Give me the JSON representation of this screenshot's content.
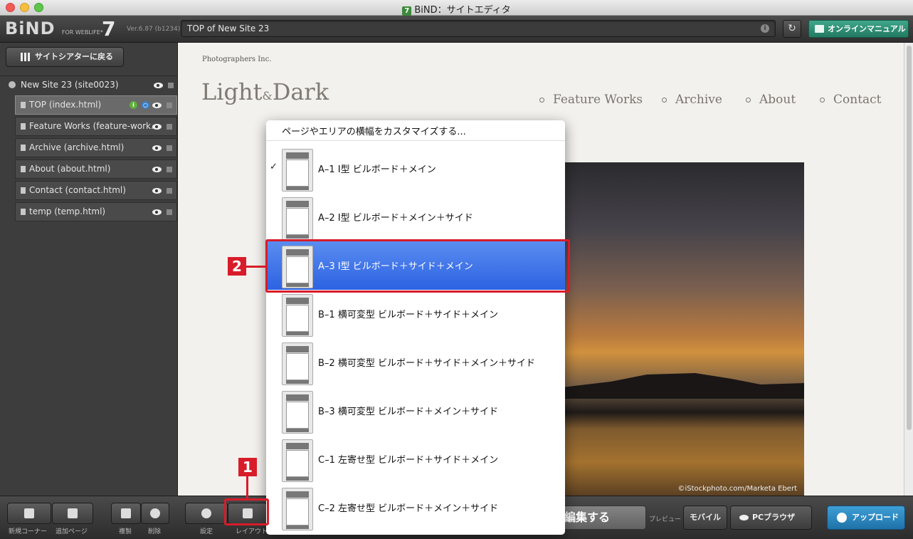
{
  "window": {
    "title": "BiND：サイトエディタ",
    "app_icon": "7"
  },
  "header": {
    "logo": "BiND",
    "logo_sub": "FOR WEBLIFE*",
    "logo_num": "7",
    "version": "Ver.6.87 (b1234)",
    "url": "TOP of New Site 23",
    "manual_label": "オンラインマニュアル"
  },
  "sidebar": {
    "back_label": "サイトシアターに戻る",
    "site_name": "New Site 23 (site0023)",
    "pages": [
      {
        "label": "TOP (index.html)"
      },
      {
        "label": "Feature Works (feature-work..."
      },
      {
        "label": "Archive (archive.html)"
      },
      {
        "label": "About (about.html)"
      },
      {
        "label": "Contact (contact.html)"
      },
      {
        "label": "temp (temp.html)"
      }
    ]
  },
  "preview": {
    "company": "Photographers Inc.",
    "logo_a": "Light",
    "logo_amp": "&",
    "logo_b": "Dark",
    "nav": [
      "Feature Works",
      "Archive",
      "About",
      "Contact"
    ],
    "photo_credit": "©iStockphoto.com/Marketa Ebert"
  },
  "menu": {
    "header": "ページやエリアの横幅をカスタマイズする...",
    "items": [
      {
        "label": "A–1 I型 ビルボード＋メイン",
        "checked": true
      },
      {
        "label": "A–2 I型 ビルボード＋メイン＋サイド"
      },
      {
        "label": "A–3 I型 ビルボード＋サイド＋メイン",
        "highlighted": true
      },
      {
        "label": "B–1 横可変型 ビルボード＋サイド＋メイン"
      },
      {
        "label": "B–2 横可変型 ビルボード＋サイド＋メイン＋サイド"
      },
      {
        "label": "B–3 横可変型 ビルボード＋メイン＋サイド"
      },
      {
        "label": "C–1 左寄せ型 ビルボード＋サイド＋メイン"
      },
      {
        "label": "C–2 左寄せ型 ビルボード＋メイン＋サイド"
      }
    ]
  },
  "bottombar": {
    "new_corner": "新規コーナー",
    "add_page": "追加ページ",
    "duplicate": "複製",
    "delete": "削除",
    "settings": "設定",
    "layout": "レイアウト",
    "edit_label": "編集する",
    "preview_label": "プレビュー",
    "mobile_label": "モバイル",
    "pc_browser_label": "PCブラウザ",
    "upload_label": "アップロード"
  },
  "annotations": {
    "one": "1",
    "two": "2"
  },
  "colors": {
    "annotation": "#d81c2a",
    "highlight": "#2d62e2",
    "upload": "#1f72a8",
    "manual": "#237a62"
  }
}
